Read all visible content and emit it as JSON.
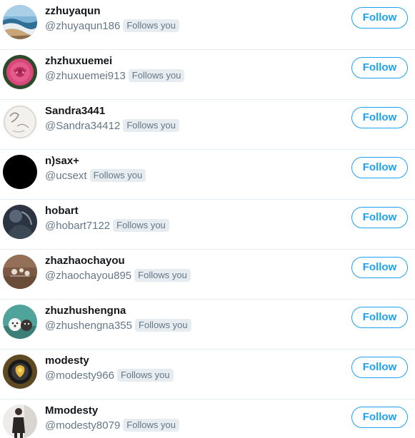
{
  "users": [
    {
      "display_name": "zzhuyaqun",
      "handle": "@zhuyaqun186",
      "badge": "Follows you",
      "button": "Follow",
      "avatar": "beach-waves-avatar"
    },
    {
      "display_name": "zhzhuxuemei",
      "handle": "@zhuxuemei913",
      "badge": "Follows you",
      "button": "Follow",
      "avatar": "pink-rose-avatar"
    },
    {
      "display_name": "Sandra3441",
      "handle": "@Sandra34412",
      "badge": "Follows you",
      "button": "Follow",
      "avatar": "sketch-avatar"
    },
    {
      "display_name": "n)sax+",
      "handle": "@ucsext",
      "badge": "Follows you",
      "button": "Follow",
      "avatar": "black-avatar"
    },
    {
      "display_name": "hobart",
      "handle": "@hobart7122",
      "badge": "Follows you",
      "button": "Follow",
      "avatar": "dark-portrait-avatar"
    },
    {
      "display_name": "zhazhaochayou",
      "handle": "@zhaochayou895",
      "badge": "Follows you",
      "button": "Follow",
      "avatar": "brown-texture-avatar"
    },
    {
      "display_name": "zhuzhushengna",
      "handle": "@zhushengna355",
      "badge": "Follows you",
      "button": "Follow",
      "avatar": "puppies-avatar"
    },
    {
      "display_name": "modesty",
      "handle": "@modesty966",
      "badge": "Follows you",
      "button": "Follow",
      "avatar": "gold-object-avatar"
    },
    {
      "display_name": "Mmodesty",
      "handle": "@modesty8079",
      "badge": "Follows you",
      "button": "Follow",
      "avatar": "standing-person-avatar"
    }
  ],
  "colors": {
    "accent": "#1da1f2",
    "name_text": "#14171a",
    "secondary_text": "#657786",
    "badge_bg": "#e6ecf0",
    "divider": "#e6ecf0"
  }
}
